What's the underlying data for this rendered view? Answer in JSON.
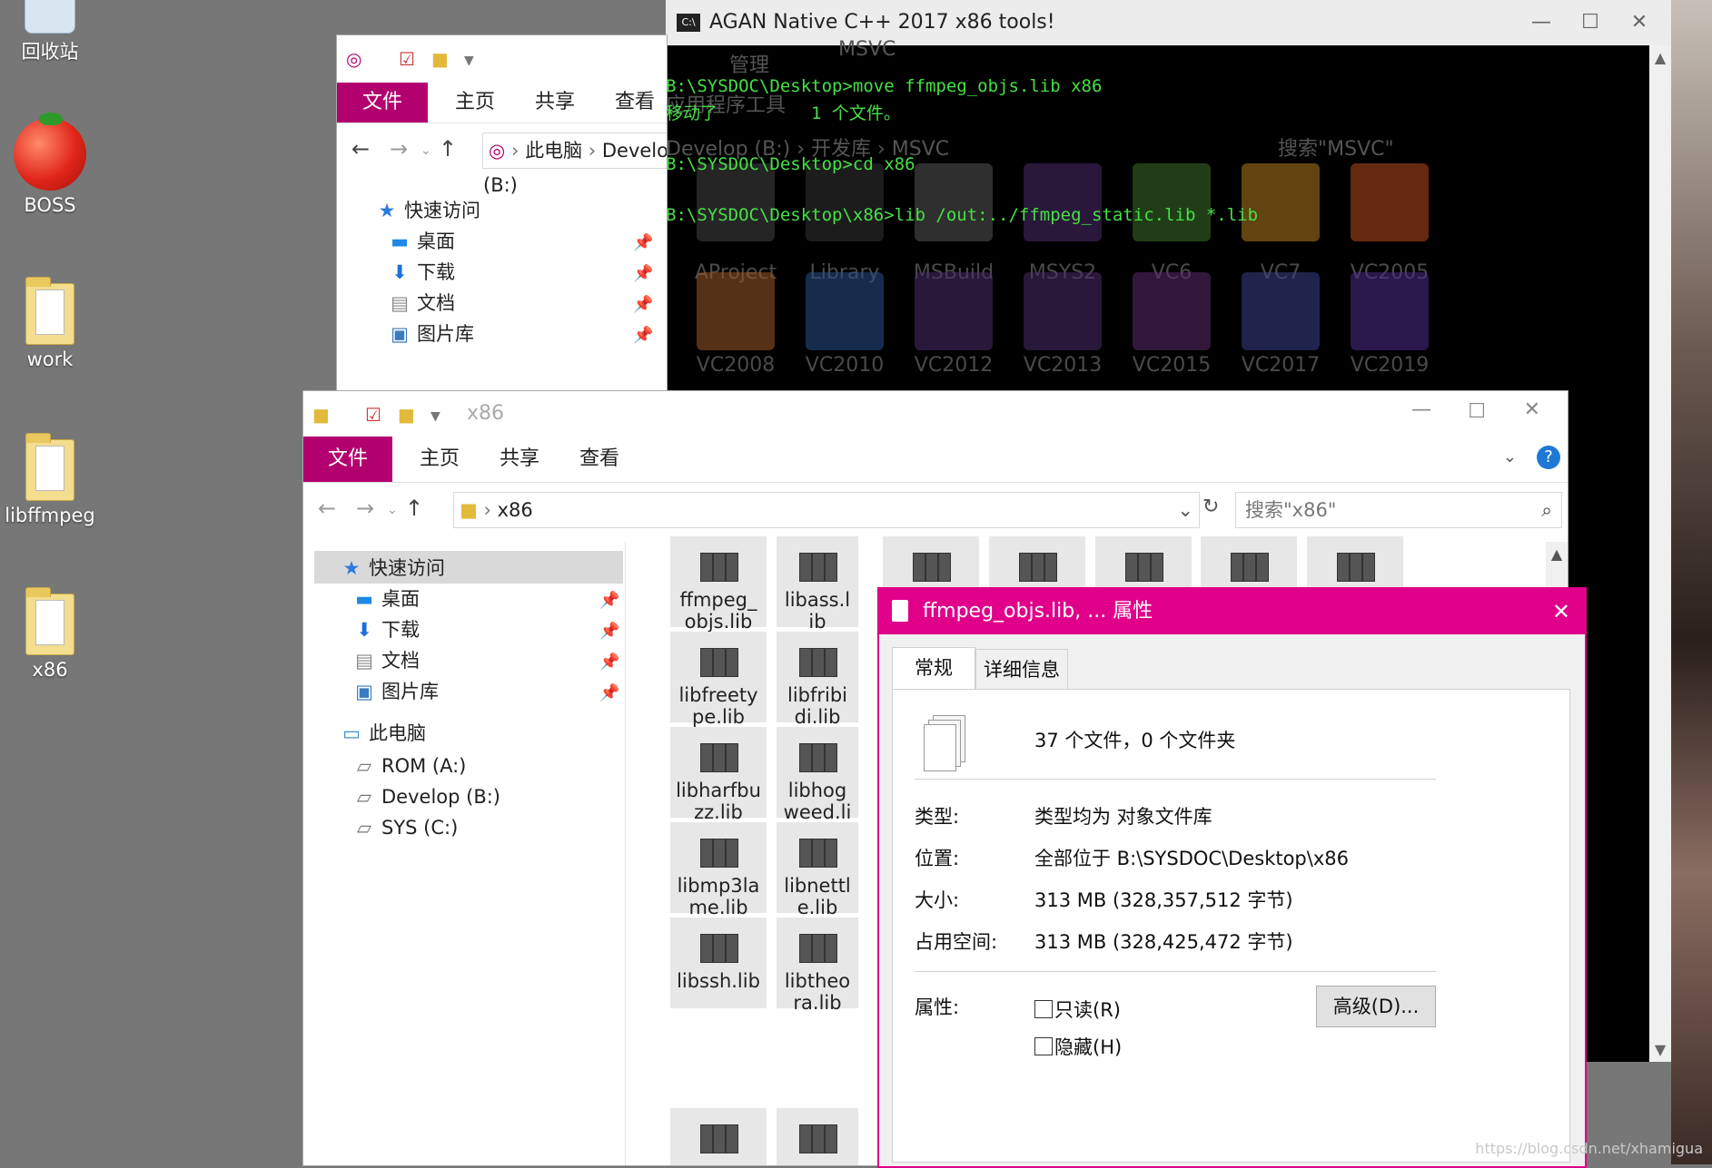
{
  "desktop": {
    "icons": [
      {
        "label": "回收站"
      },
      {
        "label": "BOSS"
      },
      {
        "label": "work"
      },
      {
        "label": "libffmpeg"
      },
      {
        "label": "x86"
      }
    ]
  },
  "terminal": {
    "title": "AGAN Native C++ 2017 x86 tools!",
    "lines": [
      "B:\\SYSDOC\\Desktop>move ffmpeg_objs.lib x86",
      "移动了         1 个文件。",
      "B:\\SYSDOC\\Desktop>cd x86",
      "B:\\SYSDOC\\Desktop\\x86>lib /out:../ffmpeg_static.lib *.lib"
    ],
    "ghost": {
      "manage": "管理",
      "app_tools": "应用程序工具",
      "crumb": "Develop (B:)  ›  开发库  ›  MSVC",
      "search": "搜索\"MSVC\"",
      "title_msvc": "MSVC",
      "row1": [
        "AProject",
        "Library",
        "MSBuild",
        "MSYS2",
        "VC6",
        "VC7",
        "VC2005"
      ],
      "row2": [
        "VC2008",
        "VC2010",
        "VC2012",
        "VC2013",
        "VC2015",
        "VC2017",
        "VC2019"
      ]
    }
  },
  "explorer_back": {
    "tabs": {
      "file": "文件",
      "home": "主页",
      "share": "共享",
      "view": "查看"
    },
    "breadcrumb": [
      "此电脑",
      "Develop (B:)",
      "开发库",
      "MSVC"
    ],
    "nav": {
      "quick_access": "快速访问",
      "desktop": "桌面",
      "downloads": "下载",
      "documents": "文档",
      "pictures": "图片库"
    }
  },
  "explorer_front": {
    "title": "x86",
    "tabs": {
      "file": "文件",
      "home": "主页",
      "share": "共享",
      "view": "查看"
    },
    "address": "x86",
    "search_placeholder": "搜索\"x86\"",
    "nav": {
      "quick_access": "快速访问",
      "desktop": "桌面",
      "downloads": "下载",
      "documents": "文档",
      "pictures": "图片库",
      "this_pc": "此电脑",
      "drive_a": "ROM (A:)",
      "drive_b": "Develop (B:)",
      "drive_c": "SYS (C:)"
    },
    "files": [
      {
        "name": "ffmpeg_objs.lib"
      },
      {
        "name": "libass.lib"
      },
      {
        "name": "libfreetype.lib"
      },
      {
        "name": "libfribidi.lib"
      },
      {
        "name": "libharfbuzz.lib"
      },
      {
        "name": "libhogweed.lib"
      },
      {
        "name": "libmp3lame.lib"
      },
      {
        "name": "libnettle.lib"
      },
      {
        "name": "libssh.lib"
      },
      {
        "name": "libtheora.lib"
      }
    ]
  },
  "properties": {
    "title": "ffmpeg_objs.lib, ... 属性",
    "tab_general": "常规",
    "tab_details": "详细信息",
    "summary": "37 个文件，0 个文件夹",
    "type_label": "类型:",
    "type_value": "类型均为 对象文件库",
    "location_label": "位置:",
    "location_value": "全部位于 B:\\SYSDOC\\Desktop\\x86",
    "size_label": "大小:",
    "size_value": "313 MB (328,357,512 字节)",
    "disk_label": "占用空间:",
    "disk_value": "313 MB (328,425,472 字节)",
    "attr_label": "属性:",
    "readonly_label": "只读(R)",
    "hidden_label": "隐藏(H)",
    "advanced_button": "高级(D)..."
  },
  "watermark": "https://blog.csdn.net/xhamigua"
}
